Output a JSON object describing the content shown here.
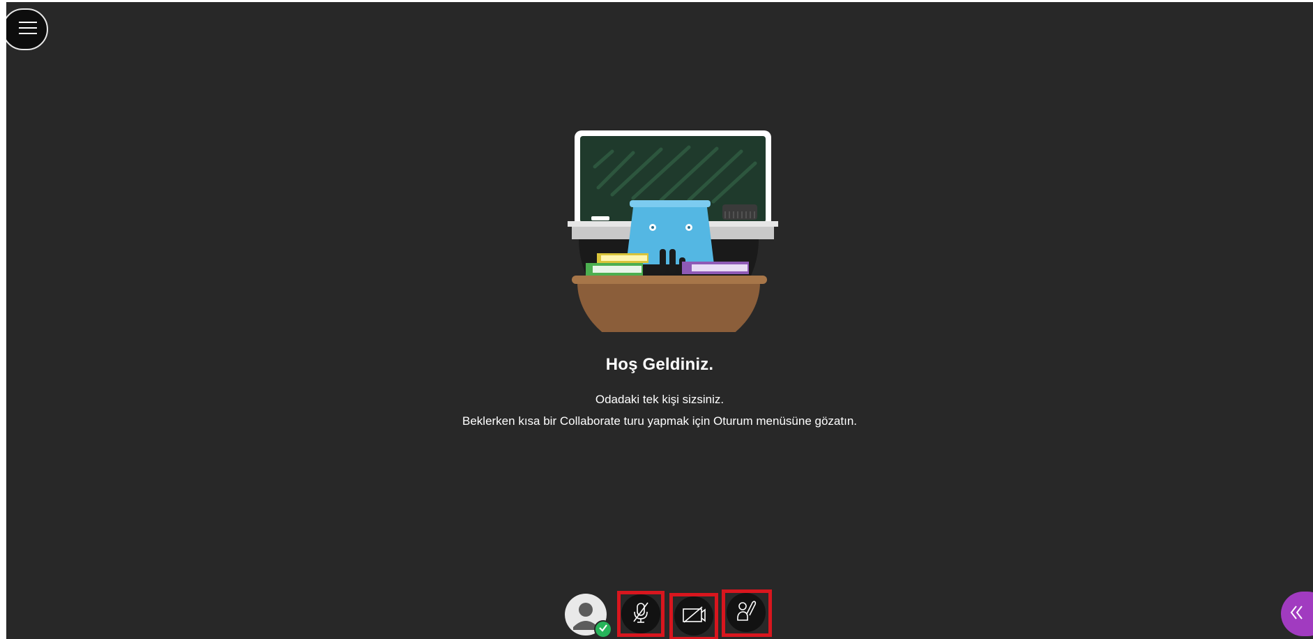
{
  "welcome": {
    "title": "Hoş Geldiniz.",
    "line1": "Odadaki tek kişi sizsiniz.",
    "line2": "Beklerken kısa bir Collaborate turu yapmak için Oturum menüsüne gözatın."
  },
  "icons": {
    "menu": "hamburger-menu-icon",
    "avatar": "user-avatar-icon",
    "status": "checkmark-icon",
    "microphone": "microphone-muted-icon",
    "camera": "camera-off-icon",
    "hand": "raise-hand-icon",
    "collapse": "double-chevron-left-icon"
  },
  "colors": {
    "background": "#282828",
    "highlight": "#d8161e",
    "status_green": "#27b45a",
    "panel_tab": "#a13bc0"
  }
}
